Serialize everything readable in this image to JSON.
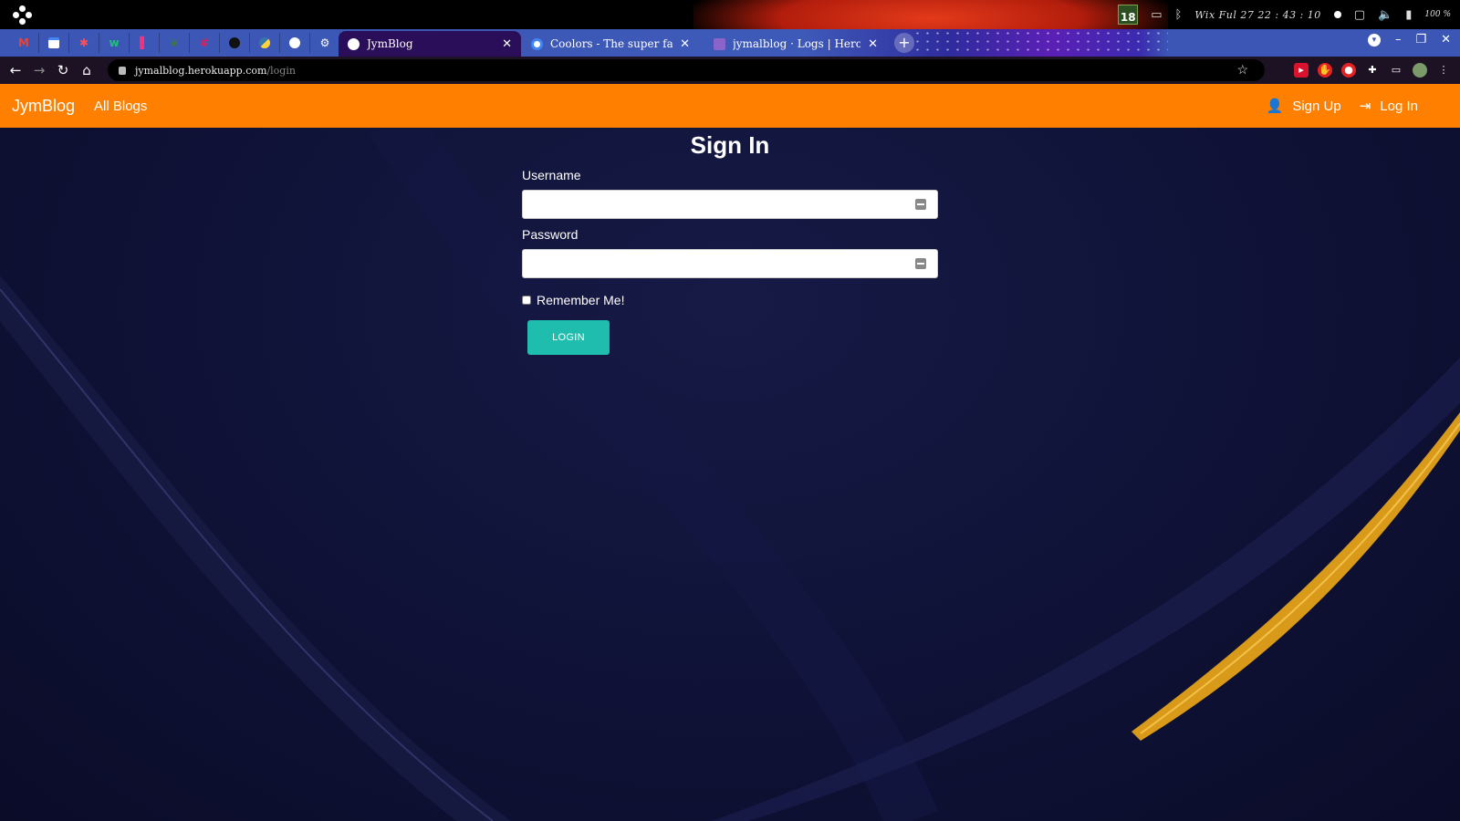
{
  "os": {
    "calendar_day": "18",
    "clock": "Wix Ful 27  22 : 43 : 10",
    "battery": "100 %"
  },
  "browser": {
    "pinned_tabs": [
      "gmail-icon",
      "calendar-icon",
      "asterisk-icon",
      "w-icon",
      "chart-icon",
      "leaf-icon",
      "slack-icon",
      "github-icon",
      "python-icon",
      "globe-icon",
      "settings-icon"
    ],
    "tabs": [
      {
        "title": "JymBlog",
        "active": true
      },
      {
        "title": "Coolors - The super fast color",
        "active": false
      },
      {
        "title": "jymalblog · Logs | Heroku",
        "active": false
      }
    ],
    "url_host": "jymalblog.herokuapp.com",
    "url_path": "/login"
  },
  "navbar": {
    "brand": "JymBlog",
    "links": [
      "All Blogs"
    ],
    "sign_up": "Sign Up",
    "log_in": "Log In",
    "color": "#ff7f00"
  },
  "form": {
    "title": "Sign In",
    "username_label": "Username",
    "username_value": "",
    "password_label": "Password",
    "password_value": "",
    "remember_label": "Remember Me!",
    "remember_checked": false,
    "submit_label": "LOGIN",
    "submit_color": "#1fbdad"
  }
}
